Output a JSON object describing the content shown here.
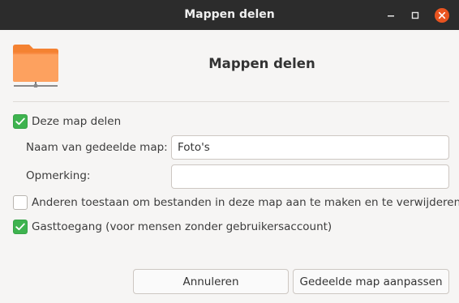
{
  "window": {
    "title": "Mappen delen"
  },
  "header": {
    "title": "Mappen delen",
    "icon": "folder-remote-icon"
  },
  "share_folder": {
    "label": "Deze map delen",
    "checked": true
  },
  "share_name": {
    "label": "Naam van gedeelde map:",
    "value": "Foto's"
  },
  "comment": {
    "label": "Opmerking:",
    "value": ""
  },
  "allow_others": {
    "label": "Anderen toestaan om bestanden in deze map aan te maken en te verwijderen",
    "checked": false
  },
  "guest_access": {
    "label": "Gasttoegang (voor mensen zonder gebruikersaccount)",
    "checked": true
  },
  "buttons": {
    "cancel": "Annuleren",
    "apply": "Gedeelde map aanpassen"
  },
  "colors": {
    "titlebar": "#2c2c2c",
    "close": "#e95420",
    "check": "#3eb34f",
    "folder": "#f48232"
  }
}
